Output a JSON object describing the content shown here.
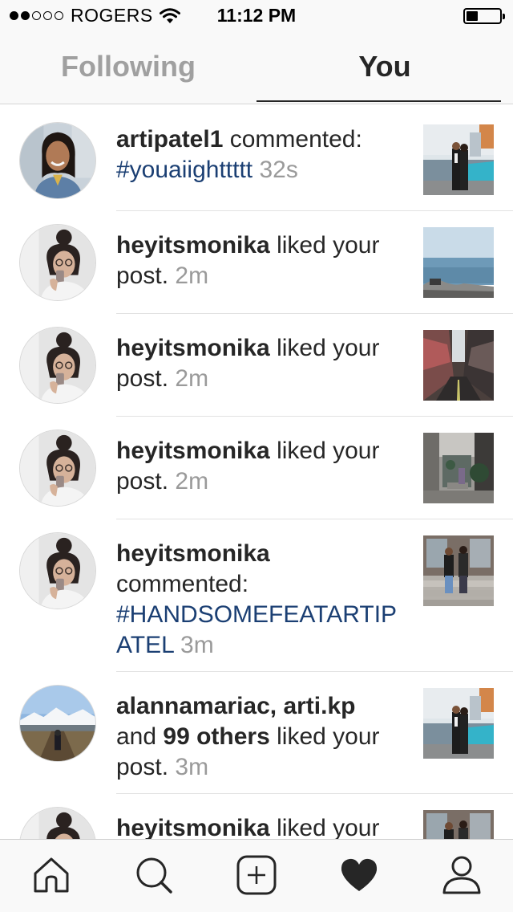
{
  "status_bar": {
    "carrier": "ROGERS",
    "time": "11:12 PM",
    "signal_bars": 2,
    "signal_total": 5,
    "battery_level": 0.35
  },
  "tabs": [
    {
      "label": "Following",
      "active": false
    },
    {
      "label": "You",
      "active": true
    }
  ],
  "feed": [
    {
      "user": "artipatel1",
      "action": " commented:",
      "tag": "#youaiighttttt",
      "time": "32s",
      "avatar_icon": "user-avatar-artipatel1",
      "thumb_icon": "post-thumbnail-couple-pool"
    },
    {
      "user": "heyitsmonika",
      "action": " liked your post.",
      "time": "2m",
      "avatar_icon": "user-avatar-heyitsmonika",
      "thumb_icon": "post-thumbnail-lake"
    },
    {
      "user": "heyitsmonika",
      "action": " liked your post.",
      "time": "2m",
      "avatar_icon": "user-avatar-heyitsmonika",
      "thumb_icon": "post-thumbnail-graffiti-alley"
    },
    {
      "user": "heyitsmonika",
      "action": " liked your post.",
      "time": "2m",
      "avatar_icon": "user-avatar-heyitsmonika",
      "thumb_icon": "post-thumbnail-courtyard"
    },
    {
      "user": "heyitsmonika",
      "action": " commented:",
      "tag": "#HANDSOMEFEATARTIPATEL",
      "time": "3m",
      "avatar_icon": "user-avatar-heyitsmonika",
      "thumb_icon": "post-thumbnail-couple-steps"
    },
    {
      "user": "alannamariac, arti.kp",
      "connector": " and ",
      "others": "99 others",
      "action": " liked your post.",
      "time": "3m",
      "avatar_icon": "user-avatar-alannamariac",
      "thumb_icon": "post-thumbnail-couple-pool"
    },
    {
      "user": "heyitsmonika",
      "action": " liked your",
      "avatar_icon": "user-avatar-heyitsmonika",
      "thumb_icon": "post-thumbnail-couple-steps"
    }
  ],
  "bottom_nav": [
    {
      "icon": "home-icon",
      "active": false
    },
    {
      "icon": "search-icon",
      "active": false
    },
    {
      "icon": "add-post-icon",
      "active": false
    },
    {
      "icon": "heart-icon",
      "active": true
    },
    {
      "icon": "profile-icon",
      "active": false
    }
  ],
  "colors": {
    "hashtag": "#1b3f73",
    "timestamp": "#9a9a9a",
    "text": "#262626",
    "inactive_tab": "#a0a0a0"
  }
}
